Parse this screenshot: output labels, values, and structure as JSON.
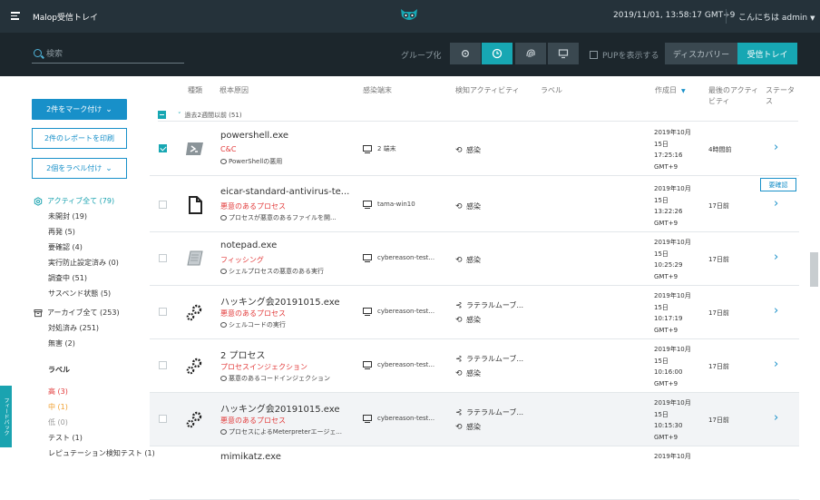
{
  "topbar": {
    "title": "Malop受信トレイ",
    "datetime": "2019/11/01, 13:58:17 GMT+9",
    "greeting": "こんにちは admin",
    "greeting_caret": "▼"
  },
  "filterbar": {
    "search_placeholder": "検索",
    "group_label": "グループ化",
    "pup_label": "PUPを表示する",
    "tab_discovery": "ディスカバリー",
    "tab_inbox": "受信トレイ"
  },
  "sidebar": {
    "mark_button": "2件をマーク付け",
    "print_button": "2件のレポートを印刷",
    "label_button": "2個をラベル付け",
    "active_head": "アクティブ全て (79)",
    "active_items": [
      "未開封 (19)",
      "再発 (5)",
      "要確認 (4)",
      "実行防止設定済み (0)",
      "調査中 (51)",
      "サスペンド状態 (5)"
    ],
    "archive_head": "アーカイブ全て (253)",
    "archive_items": [
      "対処済み (251)",
      "無害 (2)"
    ],
    "labels_head": "ラベル",
    "label_high": "高 (3)",
    "label_mid": "中 (1)",
    "label_low": "低 (0)",
    "label_test": "テスト (1)",
    "label_rep": "レピュテーション検知テスト (1)",
    "feedback": "フィードバック"
  },
  "table": {
    "col_type": "種類",
    "col_root": "根本原因",
    "col_host": "感染端末",
    "col_activity": "検知アクティビティ",
    "col_label": "ラベル",
    "col_created": "作成日",
    "col_created_sort": "▼",
    "col_last": "最後のアクティビティ",
    "col_status": "ステータス",
    "group_chevron": "˅",
    "group_title": "過去2週間以前 (51)",
    "tooltip": "要確認",
    "rows": [
      {
        "name": "powershell.exe",
        "type": "C&C",
        "desc": "PowerShellの悪用",
        "host": "2 端末",
        "act1": "",
        "act2": "感染",
        "d1": "2019年10月",
        "d2": "15日",
        "d3": "17:25:16",
        "d4": "GMT+9",
        "last": "4時間前",
        "arrow": "›",
        "checked": true,
        "icon": "powershell"
      },
      {
        "name": "eicar-standard-antivirus-te...",
        "type": "悪意のあるプロセス",
        "desc": "プロセスが悪意のあるファイルを開...",
        "host": "tama-win10",
        "act1": "",
        "act2": "感染",
        "d1": "2019年10月",
        "d2": "15日",
        "d3": "13:22:26",
        "d4": "GMT+9",
        "last": "17日前",
        "arrow": "›",
        "checked": false,
        "icon": "file"
      },
      {
        "name": "notepad.exe",
        "type": "フィッシング",
        "desc": "シェルプロセスの悪意のある実行",
        "host": "cybereason-test...",
        "act1": "",
        "act2": "感染",
        "d1": "2019年10月",
        "d2": "15日",
        "d3": "10:25:29",
        "d4": "GMT+9",
        "last": "17日前",
        "arrow": "›",
        "checked": false,
        "icon": "notepad"
      },
      {
        "name": "ハッキング会20191015.exe",
        "type": "悪意のあるプロセス",
        "desc": "シェルコードの実行",
        "host": "cybereason-test...",
        "act1": "ラテラルムーブ...",
        "act2": "感染",
        "d1": "2019年10月",
        "d2": "15日",
        "d3": "10:17:19",
        "d4": "GMT+9",
        "last": "17日前",
        "arrow": "›",
        "checked": false,
        "icon": "gear"
      },
      {
        "name": "2 プロセス",
        "type": "プロセスインジェクション",
        "desc": "悪意のあるコードインジェクション",
        "host": "cybereason-test...",
        "act1": "ラテラルムーブ...",
        "act2": "感染",
        "d1": "2019年10月",
        "d2": "15日",
        "d3": "10:16:00",
        "d4": "GMT+9",
        "last": "17日前",
        "arrow": "›",
        "checked": false,
        "icon": "gear"
      },
      {
        "name": "ハッキング会20191015.exe",
        "type": "悪意のあるプロセス",
        "desc": "プロセスによるMeterpreterエージェ...",
        "host": "cybereason-test...",
        "act1": "ラテラルムーブ...",
        "act2": "感染",
        "d1": "2019年10月",
        "d2": "15日",
        "d3": "10:15:30",
        "d4": "GMT+9",
        "last": "17日前",
        "arrow": "›",
        "checked": false,
        "icon": "gear"
      },
      {
        "name": "mimikatz.exe",
        "type": "",
        "desc": "",
        "host": "",
        "act1": "",
        "act2": "",
        "d1": "2019年10月",
        "d2": "",
        "d3": "",
        "d4": "",
        "last": "",
        "arrow": "",
        "checked": false,
        "icon": "none"
      }
    ]
  },
  "colors": {
    "accent": "#17a7b3",
    "link": "#1890c9",
    "danger": "#e23a3a",
    "topbar": "#25323a",
    "filterbar": "#1c262c"
  }
}
